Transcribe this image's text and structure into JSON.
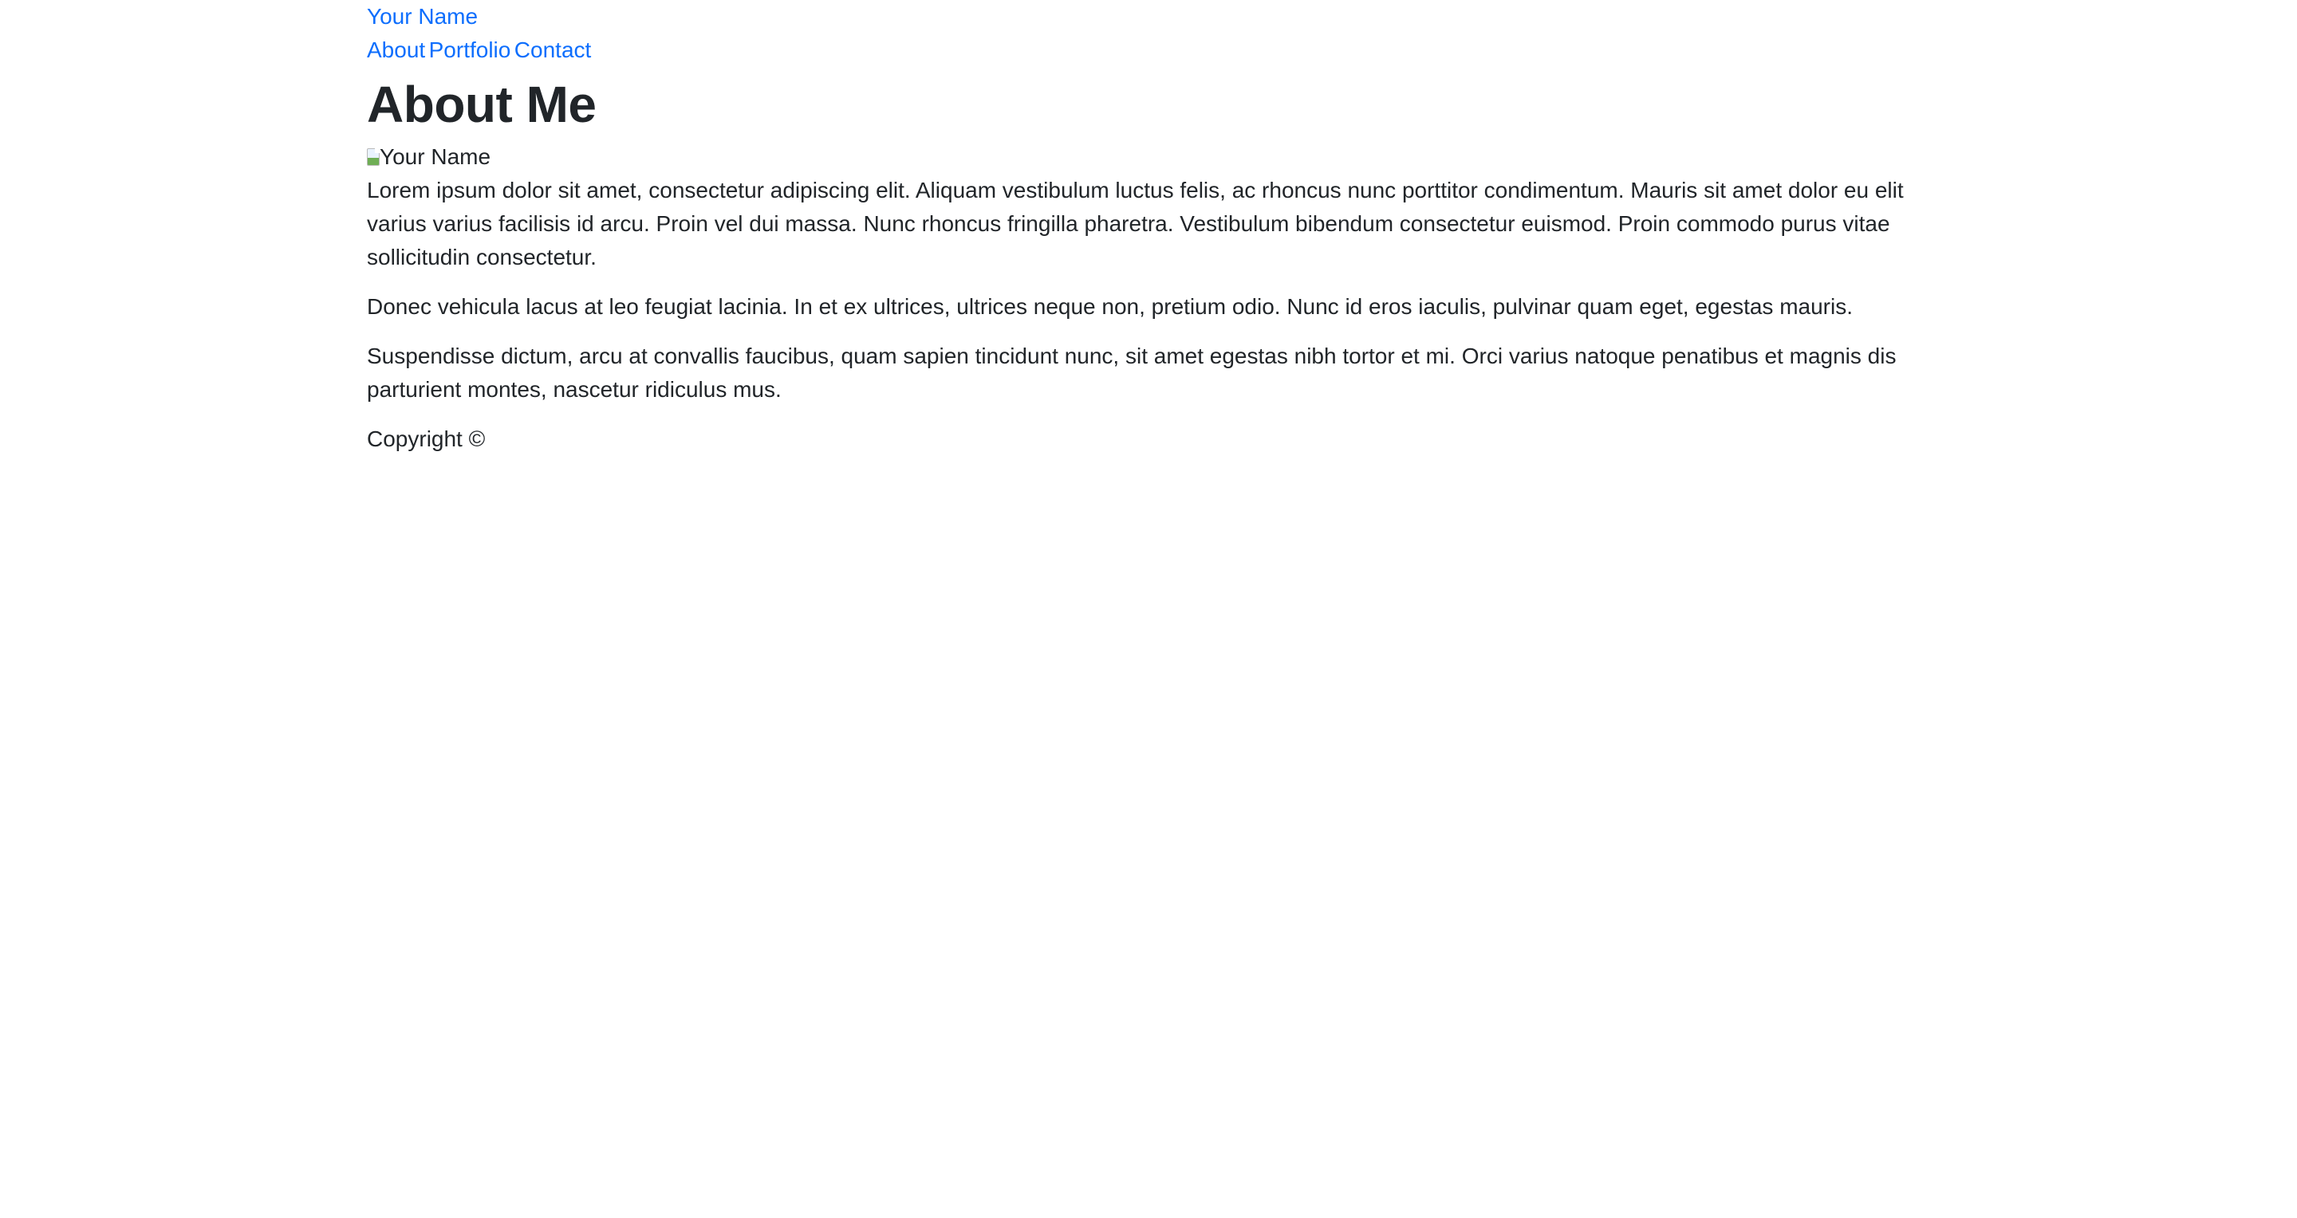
{
  "header": {
    "brand": "Your Name",
    "nav": [
      {
        "label": "About"
      },
      {
        "label": "Portfolio"
      },
      {
        "label": "Contact"
      }
    ]
  },
  "main": {
    "title": "About Me",
    "image_alt": "Your Name",
    "paragraphs": [
      "Lorem ipsum dolor sit amet, consectetur adipiscing elit. Aliquam vestibulum luctus felis, ac rhoncus nunc porttitor condimentum. Mauris sit amet dolor eu elit varius varius facilisis id arcu. Proin vel dui massa. Nunc rhoncus fringilla pharetra. Vestibulum bibendum consectetur euismod. Proin commodo purus vitae sollicitudin consectetur.",
      "Donec vehicula lacus at leo feugiat lacinia. In et ex ultrices, ultrices neque non, pretium odio. Nunc id eros iaculis, pulvinar quam eget, egestas mauris.",
      "Suspendisse dictum, arcu at convallis faucibus, quam sapien tincidunt nunc, sit amet egestas nibh tortor et mi. Orci varius natoque penatibus et magnis dis parturient montes, nascetur ridiculus mus."
    ]
  },
  "footer": {
    "copyright": "Copyright ©"
  },
  "colors": {
    "link": "#0d6efd",
    "text": "#212529",
    "background": "#ffffff"
  }
}
